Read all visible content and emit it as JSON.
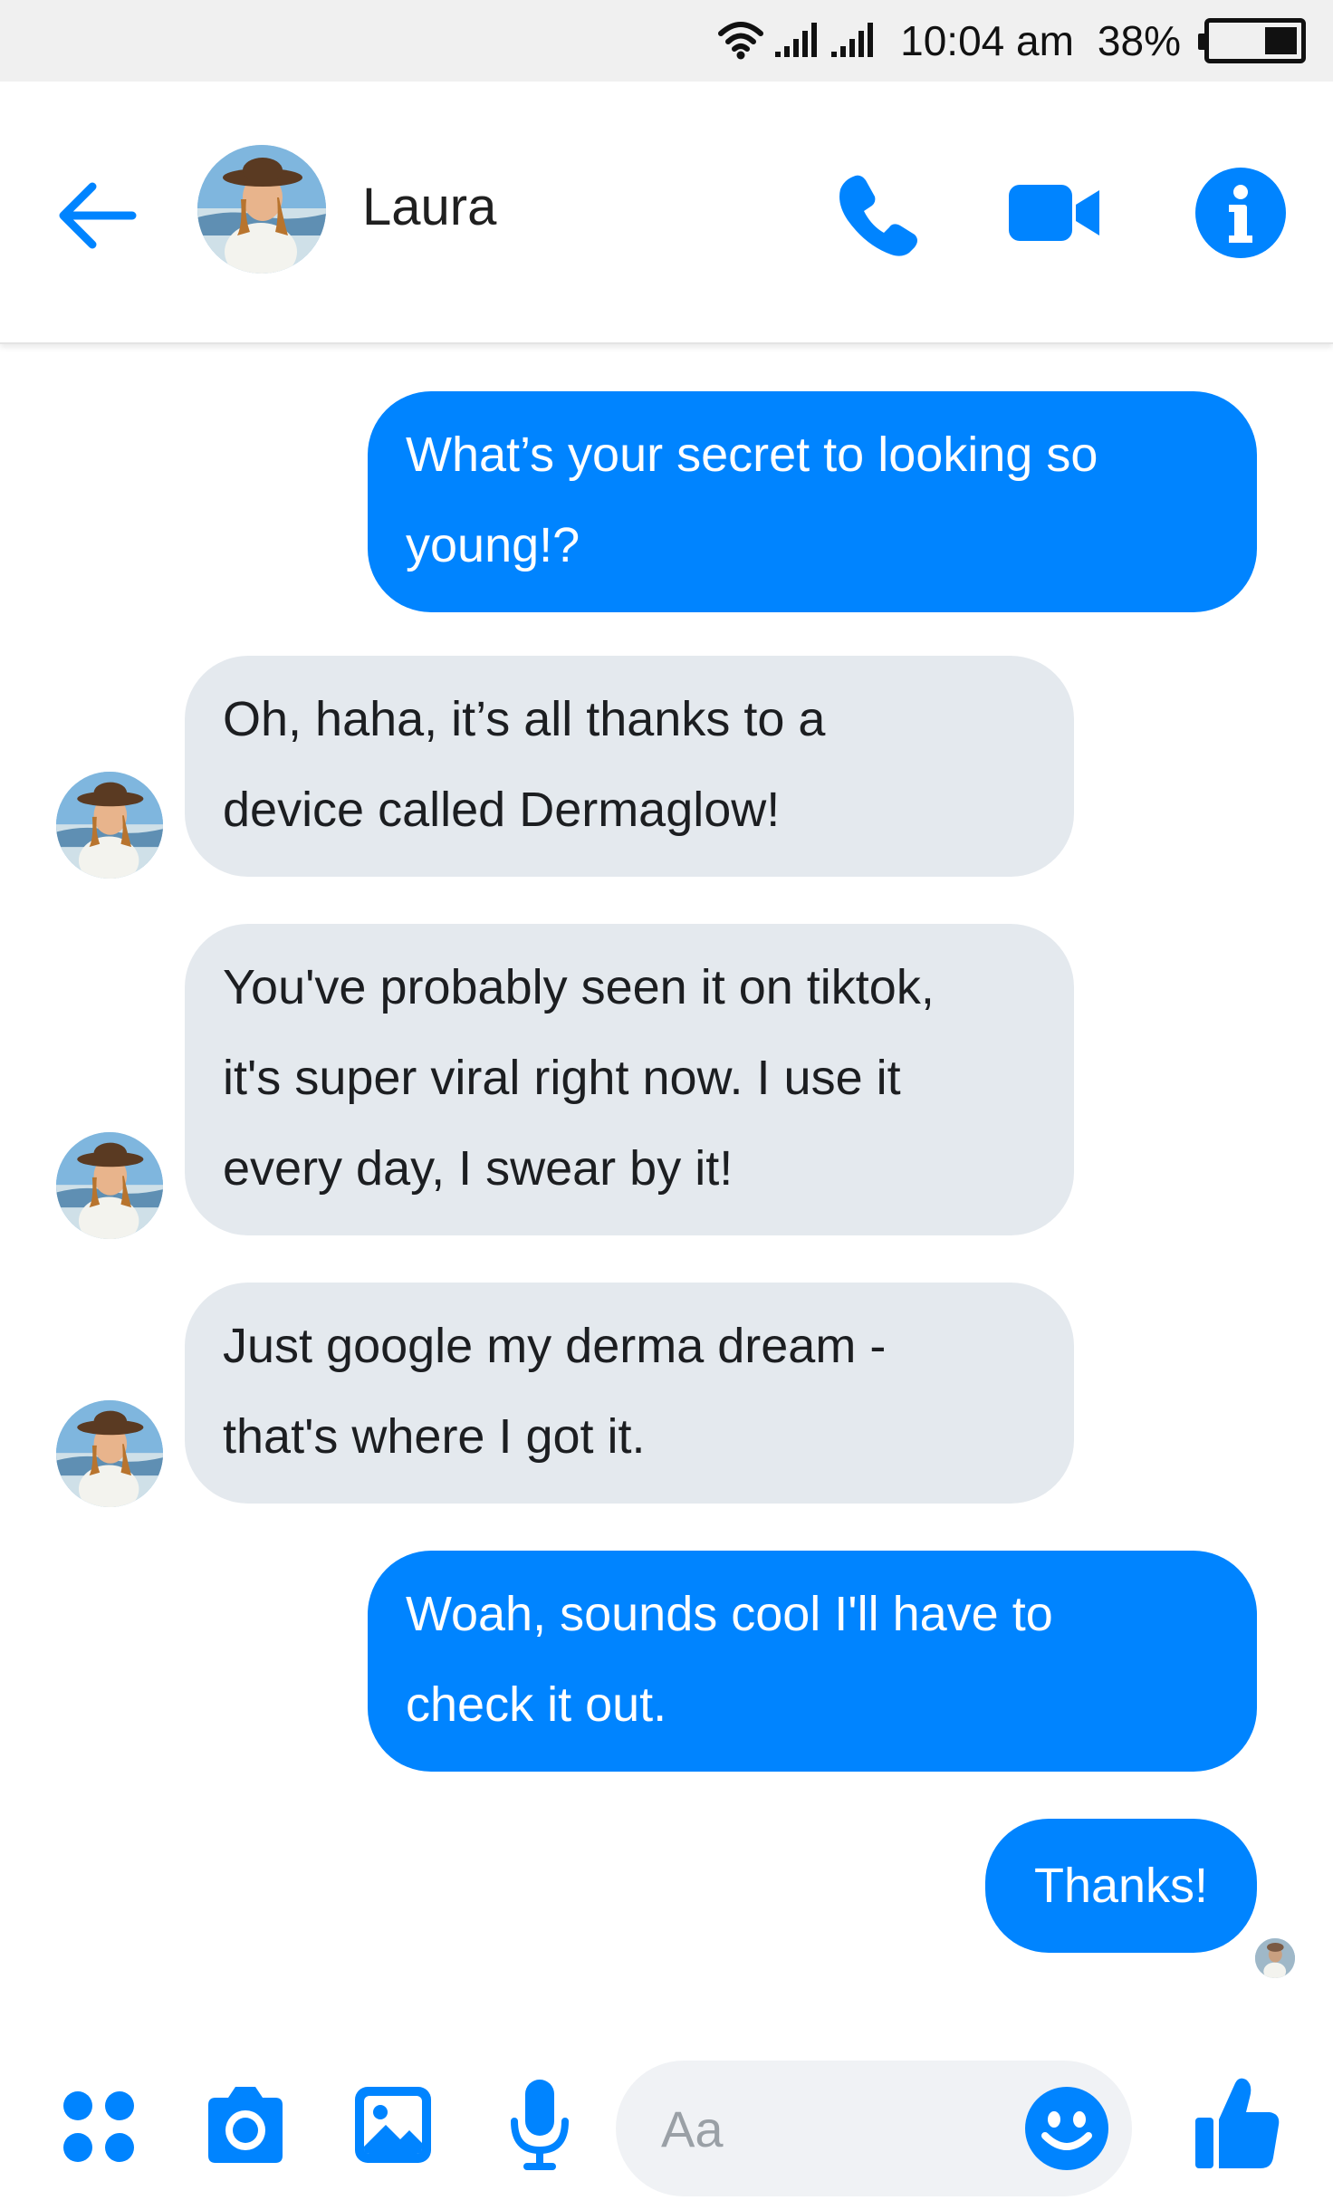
{
  "status_bar": {
    "time": "10:04 am",
    "battery": "38%",
    "battery_level": 0.38,
    "icons": [
      "wifi-icon",
      "signal-icon",
      "signal-icon",
      "battery-icon"
    ]
  },
  "header": {
    "contact_name": "Laura",
    "actions": [
      "back-arrow-icon",
      "phone-icon",
      "video-camera-icon",
      "info-icon"
    ]
  },
  "messages": [
    {
      "direction": "outgoing",
      "text_lines": [
        "What’s your secret to looking so",
        "young!?"
      ]
    },
    {
      "direction": "incoming",
      "text_lines": [
        "Oh, haha, it’s all thanks to a",
        "device called Dermaglow!"
      ]
    },
    {
      "direction": "incoming",
      "text_lines": [
        "You've probably seen it on tiktok,",
        "it's super viral right now. I use it",
        "every day, I swear by it!"
      ]
    },
    {
      "direction": "incoming",
      "text_lines": [
        "Just google my derma dream -",
        "that's where I got it."
      ]
    },
    {
      "direction": "outgoing",
      "text_lines": [
        "Woah, sounds cool I'll have to",
        "check it out."
      ]
    },
    {
      "direction": "outgoing",
      "text_lines": [
        "Thanks!"
      ]
    }
  ],
  "composer": {
    "placeholder": "Aa",
    "value": "",
    "icons": [
      "menu-dots-icon",
      "camera-icon",
      "image-icon",
      "microphone-icon",
      "emoji-icon",
      "thumbs-up-icon"
    ]
  },
  "colors": {
    "accent": "#0084ff",
    "outgoing_bubble": "#0084ff",
    "incoming_bubble": "#e4e9ee",
    "status_bar": "#f0f0f0"
  }
}
